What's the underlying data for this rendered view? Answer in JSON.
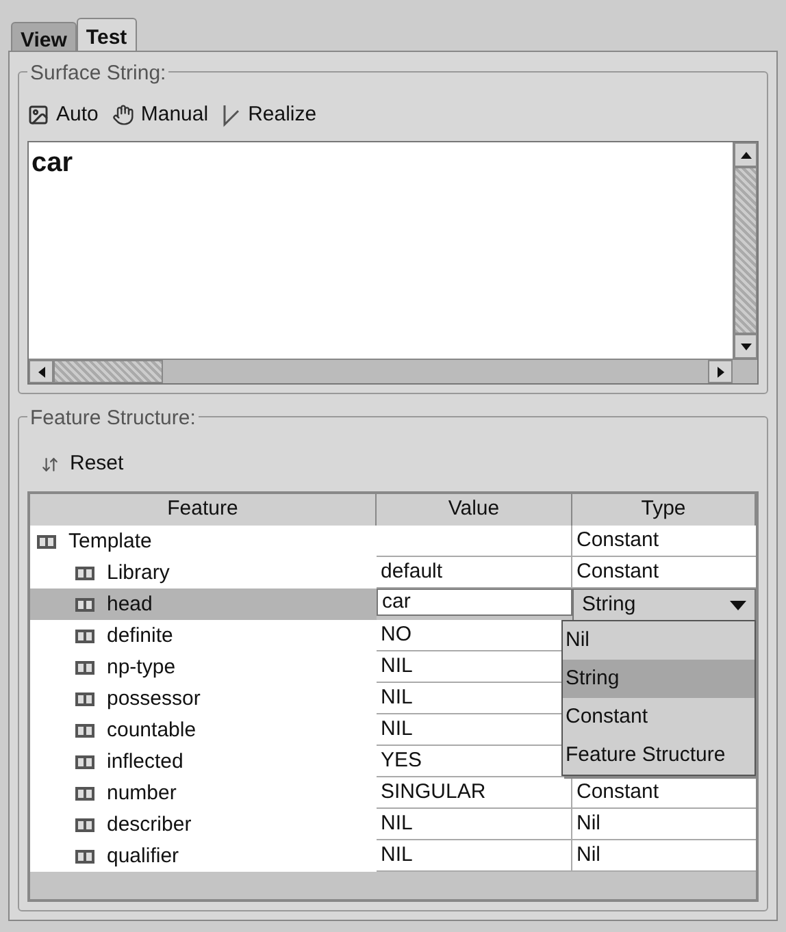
{
  "tabs": [
    {
      "label": "View",
      "selected": false
    },
    {
      "label": "Test",
      "selected": true
    }
  ],
  "surface_string": {
    "title": "Surface String:",
    "toolbar": [
      {
        "label": "Auto",
        "kind": "auto"
      },
      {
        "label": "Manual",
        "kind": "manual"
      },
      {
        "label": "Realize",
        "kind": "realize"
      }
    ],
    "text": "car"
  },
  "feature_structure": {
    "title": "Feature Structure:",
    "reset": "Reset",
    "table": {
      "columns": [
        "Feature",
        "Value",
        "Type"
      ],
      "rows": [
        {
          "feature": "Template",
          "value": "",
          "type": "Constant",
          "selected": false,
          "children": [
            {
              "feature": "Library",
              "value": "default",
              "type": "Constant",
              "selected": false
            },
            {
              "feature": "head",
              "value": "car",
              "type": "String",
              "selected": true
            },
            {
              "feature": "definite",
              "value": "NO",
              "selected": false
            },
            {
              "feature": "np-type",
              "value": "NIL",
              "selected": false
            },
            {
              "feature": "possessor",
              "value": "NIL",
              "selected": false
            },
            {
              "feature": "countable",
              "value": "NIL",
              "selected": false
            },
            {
              "feature": "inflected",
              "value": "YES",
              "selected": false
            },
            {
              "feature": "number",
              "value": "SINGULAR",
              "type": "Constant",
              "selected": false
            },
            {
              "feature": "describer",
              "value": "NIL",
              "type": "Nil",
              "selected": false
            },
            {
              "feature": "qualifier",
              "value": "NIL",
              "type": "Nil",
              "selected": false
            }
          ]
        }
      ]
    },
    "dropdown": [
      {
        "label": "Nil",
        "selected": false
      },
      {
        "label": "String",
        "selected": true
      },
      {
        "label": "Constant",
        "selected": false
      },
      {
        "label": "Feature Structure",
        "selected": false
      }
    ]
  }
}
